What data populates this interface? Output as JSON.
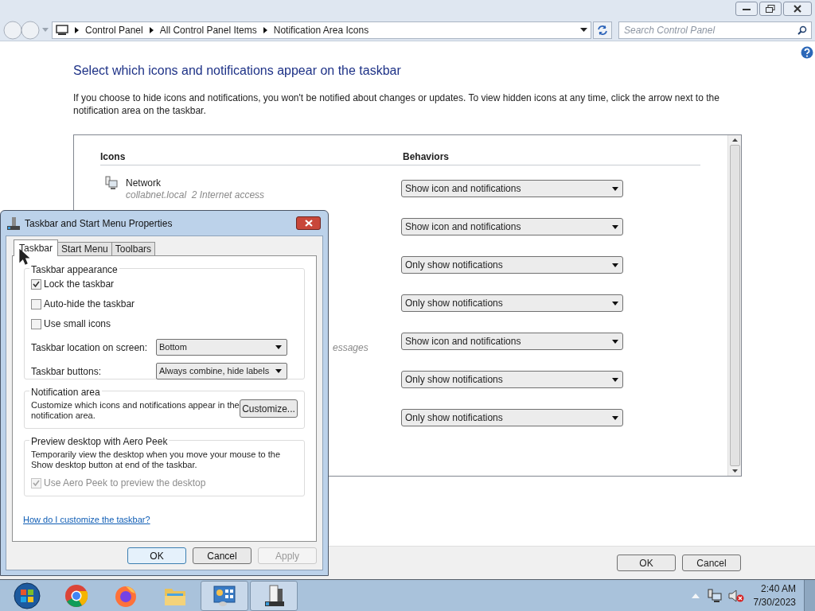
{
  "address": {
    "crumbs": [
      "Control Panel",
      "All Control Panel Items",
      "Notification Area Icons"
    ]
  },
  "search": {
    "placeholder": "Search Control Panel"
  },
  "heading": "Select which icons and notifications appear on the taskbar",
  "description": "If you choose to hide icons and notifications, you won't be notified about changes or updates. To view hidden icons at any time, click the arrow next to the notification area on the taskbar.",
  "table": {
    "columns": [
      "Icons",
      "Behaviors"
    ],
    "rows": [
      {
        "kind": "item",
        "name": "Network",
        "detail": "collabnet.local  2 Internet access",
        "behavior": "Show icon and notifications"
      },
      {
        "kind": "hidden",
        "behavior": "Show icon and notifications"
      },
      {
        "kind": "hidden",
        "behavior": "Only show notifications"
      },
      {
        "kind": "hidden",
        "behavior": "Only show notifications"
      },
      {
        "kind": "fragment",
        "detail": "essages",
        "behavior": "Show icon and notifications"
      },
      {
        "kind": "hidden",
        "behavior": "Only show notifications"
      },
      {
        "kind": "hidden",
        "behavior": "Only show notifications"
      }
    ]
  },
  "buttons": [
    "OK",
    "Cancel"
  ],
  "dialog": {
    "title": "Taskbar and Start Menu Properties",
    "tabs": [
      {
        "label": "Taskbar",
        "selected": true
      },
      {
        "label": "Start Menu",
        "selected": false
      },
      {
        "label": "Toolbars",
        "selected": false
      }
    ],
    "appearance": {
      "legend": "Taskbar appearance",
      "checkboxes": [
        {
          "label": "Lock the taskbar",
          "checked": true
        },
        {
          "label": "Auto-hide the taskbar",
          "checked": false
        },
        {
          "label": "Use small icons",
          "checked": false
        }
      ],
      "selects": [
        {
          "label": "Taskbar location on screen:",
          "value": "Bottom"
        },
        {
          "label": "Taskbar buttons:",
          "value": "Always combine, hide labels"
        }
      ]
    },
    "notification": {
      "legend": "Notification area",
      "text": "Customize which icons and notifications appear in the notification area.",
      "button": "Customize..."
    },
    "peek": {
      "legend": "Preview desktop with Aero Peek",
      "text": "Temporarily view the desktop when you move your mouse to the Show desktop button at end of the taskbar.",
      "checkbox": {
        "label": "Use Aero Peek to preview the desktop",
        "checked": true,
        "disabled": true
      }
    },
    "link": "How do I customize the taskbar?",
    "buttons": [
      {
        "label": "OK",
        "disabled": false
      },
      {
        "label": "Cancel",
        "disabled": false
      },
      {
        "label": "Apply",
        "disabled": true
      }
    ]
  },
  "taskbar": {
    "apps": [
      {
        "kind": "chrome",
        "open": false
      },
      {
        "kind": "firefox",
        "open": false
      },
      {
        "kind": "folder",
        "open": false
      },
      {
        "kind": "control-panel",
        "open": true
      },
      {
        "kind": "properties",
        "open": true
      }
    ],
    "time": "2:40 AM",
    "date": "7/30/2023"
  }
}
